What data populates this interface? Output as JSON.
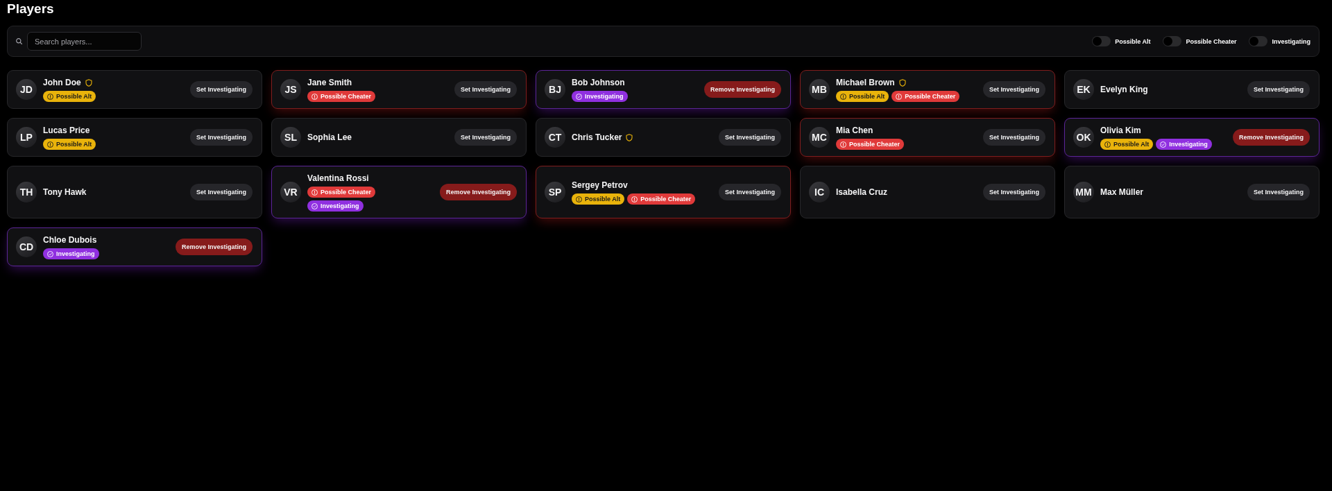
{
  "title": "Players",
  "toolbar": {
    "search": {
      "placeholder": "Search players..."
    },
    "filters": [
      {
        "label": "Possible Alt",
        "on": false
      },
      {
        "label": "Possible Cheater",
        "on": false
      },
      {
        "label": "Investigating",
        "on": false
      }
    ]
  },
  "players": [
    {
      "initials": "JD",
      "name": "John Doe",
      "shield": true,
      "badges": [
        {
          "kind": "alt",
          "label": "Possible Alt"
        }
      ],
      "button": {
        "kind": "set",
        "label": "Set Investigating"
      }
    },
    {
      "initials": "JS",
      "name": "Jane Smith",
      "shield": false,
      "badges": [
        {
          "kind": "cheater",
          "label": "Possible Cheater"
        }
      ],
      "button": {
        "kind": "set",
        "label": "Set Investigating"
      }
    },
    {
      "initials": "BJ",
      "name": "Bob Johnson",
      "shield": false,
      "badges": [
        {
          "kind": "investigating",
          "label": "Investigating"
        }
      ],
      "button": {
        "kind": "remove",
        "label": "Remove Investigating"
      }
    },
    {
      "initials": "MB",
      "name": "Michael Brown",
      "shield": true,
      "badges": [
        {
          "kind": "alt",
          "label": "Possible Alt"
        },
        {
          "kind": "cheater",
          "label": "Possible Cheater"
        }
      ],
      "button": {
        "kind": "set",
        "label": "Set Investigating"
      }
    },
    {
      "initials": "EK",
      "name": "Evelyn King",
      "shield": false,
      "button": {
        "kind": "set",
        "label": "Set Investigating"
      }
    },
    {
      "initials": "LP",
      "name": "Lucas Price",
      "shield": false,
      "badges": [
        {
          "kind": "alt",
          "label": "Possible Alt"
        }
      ],
      "button": {
        "kind": "set",
        "label": "Set Investigating"
      }
    },
    {
      "initials": "SL",
      "name": "Sophia Lee",
      "shield": false,
      "button": {
        "kind": "set",
        "label": "Set Investigating"
      }
    },
    {
      "initials": "CT",
      "name": "Chris Tucker",
      "shield": true,
      "button": {
        "kind": "set",
        "label": "Set Investigating"
      }
    },
    {
      "initials": "MC",
      "name": "Mia Chen",
      "shield": false,
      "badges": [
        {
          "kind": "cheater",
          "label": "Possible Cheater"
        }
      ],
      "button": {
        "kind": "set",
        "label": "Set Investigating"
      }
    },
    {
      "initials": "OK",
      "name": "Olivia Kim",
      "shield": false,
      "badges": [
        {
          "kind": "alt",
          "label": "Possible Alt"
        },
        {
          "kind": "investigating",
          "label": "Investigating"
        }
      ],
      "button": {
        "kind": "remove",
        "label": "Remove Investigating"
      }
    },
    {
      "initials": "TH",
      "name": "Tony Hawk",
      "shield": false,
      "button": {
        "kind": "set",
        "label": "Set Investigating"
      }
    },
    {
      "initials": "VR",
      "name": "Valentina Rossi",
      "shield": false,
      "badges": [
        {
          "kind": "cheater",
          "label": "Possible Cheater"
        },
        {
          "kind": "investigating",
          "label": "Investigating"
        }
      ],
      "button": {
        "kind": "remove",
        "label": "Remove Investigating"
      }
    },
    {
      "initials": "SP",
      "name": "Sergey Petrov",
      "shield": false,
      "badges": [
        {
          "kind": "alt",
          "label": "Possible Alt"
        },
        {
          "kind": "cheater",
          "label": "Possible Cheater"
        }
      ],
      "button": {
        "kind": "set",
        "label": "Set Investigating"
      }
    },
    {
      "initials": "IC",
      "name": "Isabella Cruz",
      "shield": false,
      "button": {
        "kind": "set",
        "label": "Set Investigating"
      }
    },
    {
      "initials": "MM",
      "name": "Max Müller",
      "shield": false,
      "button": {
        "kind": "set",
        "label": "Set Investigating"
      }
    },
    {
      "initials": "CD",
      "name": "Chloe Dubois",
      "shield": false,
      "badges": [
        {
          "kind": "investigating",
          "label": "Investigating"
        }
      ],
      "button": {
        "kind": "remove",
        "label": "Remove Investigating"
      }
    }
  ]
}
